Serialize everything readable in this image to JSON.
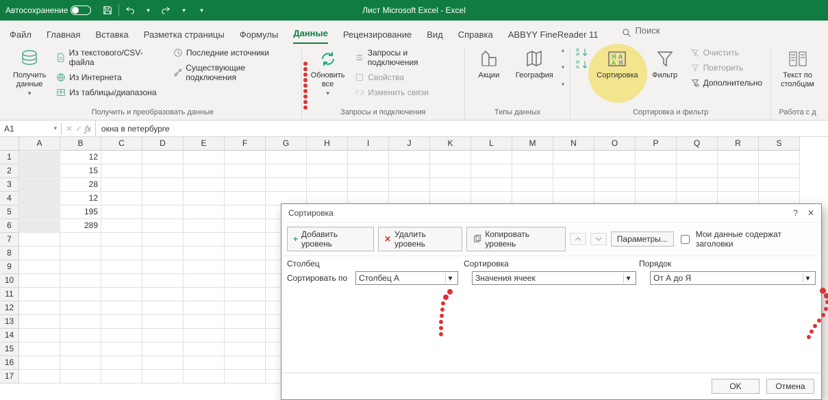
{
  "title_bar": {
    "autosave": "Автосохранение",
    "title": "Лист Microsoft Excel  -  Excel"
  },
  "tabs": {
    "file": "Файл",
    "home": "Главная",
    "insert": "Вставка",
    "layout": "Разметка страницы",
    "formulas": "Формулы",
    "data": "Данные",
    "review": "Рецензирование",
    "view": "Вид",
    "help": "Справка",
    "abbyy": "ABBYY FineReader 11",
    "search": "Поиск"
  },
  "ribbon": {
    "group1": {
      "get_data": "Получить\nданные",
      "from_csv": "Из текстового/CSV-файла",
      "from_web": "Из Интернета",
      "from_table": "Из таблицы/диапазона",
      "recent": "Последние источники",
      "existing": "Существующие подключения",
      "label": "Получить и преобразовать данные"
    },
    "group2": {
      "refresh": "Обновить\nвсе",
      "queries": "Запросы и подключения",
      "props": "Свойства",
      "links": "Изменить связи",
      "label": "Запросы и подключения"
    },
    "group3": {
      "stocks": "Акции",
      "geo": "География",
      "label": "Типы данных"
    },
    "group4": {
      "sort": "Сортировка",
      "filter": "Фильтр",
      "clear": "Очистить",
      "reapply": "Повторить",
      "advanced": "Дополнительно",
      "label": "Сортировка и фильтр"
    },
    "group5": {
      "text_to_cols": "Текст по\nстолбцам",
      "label": "Работа с д"
    }
  },
  "formula_bar": {
    "name_box": "A1",
    "formula": "окна в петербурге"
  },
  "columns": [
    "A",
    "B",
    "C",
    "D",
    "E",
    "F",
    "G",
    "H",
    "I",
    "J",
    "K",
    "L",
    "M",
    "N",
    "O",
    "P",
    "Q",
    "R",
    "S"
  ],
  "rows": [
    "1",
    "2",
    "3",
    "4",
    "5",
    "6",
    "7",
    "8",
    "9",
    "10",
    "11",
    "12",
    "13",
    "14",
    "15",
    "16",
    "17"
  ],
  "cells": {
    "B1": "12",
    "B2": "15",
    "B3": "28",
    "B4": "12",
    "B5": "195",
    "B6": "289"
  },
  "dialog": {
    "title": "Сортировка",
    "add": "Добавить уровень",
    "del": "Удалить уровень",
    "copy": "Копировать уровень",
    "params": "Параметры...",
    "chk": "Мои данные содержат заголовки",
    "h_col": "Столбец",
    "h_sort": "Сортировка",
    "h_order": "Порядок",
    "sort_by": "Сортировать по",
    "col_val": "Столбец A",
    "sort_val": "Значения ячеек",
    "order_val": "От А до Я",
    "ok": "OK",
    "cancel": "Отмена"
  }
}
